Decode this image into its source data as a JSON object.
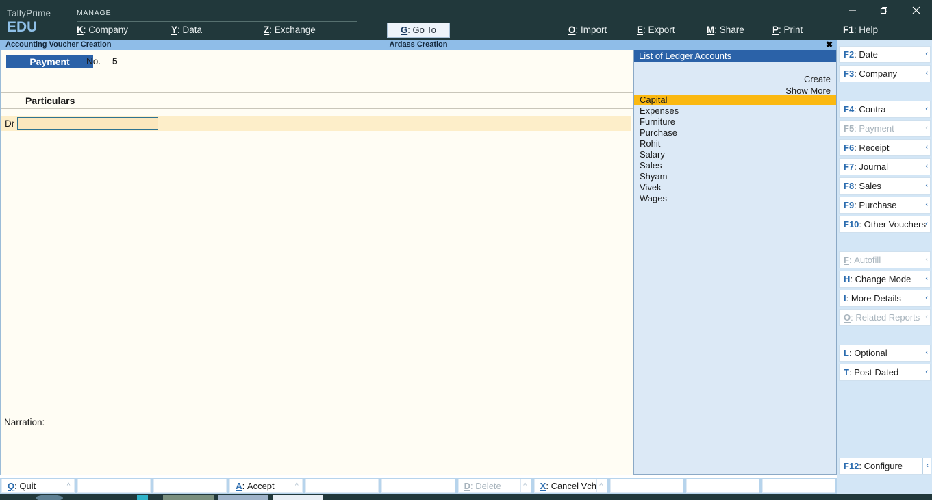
{
  "app": {
    "brand_name": "TallyPrime",
    "brand_edition": "EDU"
  },
  "topbar": {
    "section_label": "MANAGE",
    "left_menu": [
      {
        "key": "K",
        "label": "Company"
      },
      {
        "key": "Y",
        "label": "Data"
      },
      {
        "key": "Z",
        "label": "Exchange"
      }
    ],
    "goto": {
      "key": "G",
      "label": "Go To"
    },
    "right_menu": [
      {
        "key": "O",
        "label": "Import"
      },
      {
        "key": "E",
        "label": "Export"
      },
      {
        "key": "M",
        "label": "Share"
      },
      {
        "key": "P",
        "label": "Print"
      },
      {
        "key": "F1",
        "label": "Help"
      }
    ],
    "window_controls": [
      {
        "name": "minimize-icon"
      },
      {
        "name": "restore-icon"
      },
      {
        "name": "close-icon"
      }
    ]
  },
  "subtitle_bar": {
    "left": "Accounting Voucher Creation",
    "center": "Ardass Creation",
    "close": "✖"
  },
  "voucher": {
    "type_badge": "Payment",
    "number_label": "No.",
    "number_value": "5",
    "column_header": "Particulars",
    "entry_side": "Dr",
    "entry_value": "",
    "narration_label": "Narration:"
  },
  "ledger_panel": {
    "title": "List of Ledger Accounts",
    "actions": [
      "Create",
      "Show More"
    ],
    "items": [
      "Capital",
      "Expenses",
      "Furniture",
      "Purchase",
      "Rohit",
      "Salary",
      "Sales",
      "Shyam",
      "Vivek",
      "Wages"
    ],
    "selected_index": 0
  },
  "sidebar": {
    "groups": [
      {
        "items": [
          {
            "key": "F2",
            "label": "Date",
            "disabled": false,
            "underline_key": false
          },
          {
            "key": "F3",
            "label": "Company",
            "disabled": false,
            "underline_key": false
          }
        ]
      },
      {
        "items": [
          {
            "key": "F4",
            "label": "Contra",
            "disabled": false,
            "underline_key": false
          },
          {
            "key": "F5",
            "label": "Payment",
            "disabled": true,
            "underline_key": false
          },
          {
            "key": "F6",
            "label": "Receipt",
            "disabled": false,
            "underline_key": false
          },
          {
            "key": "F7",
            "label": "Journal",
            "disabled": false,
            "underline_key": false
          },
          {
            "key": "F8",
            "label": "Sales",
            "disabled": false,
            "underline_key": false
          },
          {
            "key": "F9",
            "label": "Purchase",
            "disabled": false,
            "underline_key": false
          },
          {
            "key": "F10",
            "label": "Other Vouchers",
            "disabled": false,
            "underline_key": false
          }
        ]
      },
      {
        "items": [
          {
            "key": "F",
            "label": "Autofill",
            "disabled": true,
            "underline_key": true
          },
          {
            "key": "H",
            "label": "Change Mode",
            "disabled": false,
            "underline_key": true
          },
          {
            "key": "I",
            "label": "More Details",
            "disabled": false,
            "underline_key": true
          },
          {
            "key": "O",
            "label": "Related Reports",
            "disabled": true,
            "underline_key": true
          }
        ]
      },
      {
        "items": [
          {
            "key": "L",
            "label": "Optional",
            "disabled": false,
            "underline_key": true
          },
          {
            "key": "T",
            "label": "Post-Dated",
            "disabled": false,
            "underline_key": true
          }
        ]
      }
    ],
    "footer": {
      "key": "F12",
      "label": "Configure",
      "disabled": false,
      "underline_key": false
    },
    "chevron": "‹"
  },
  "bottom_bar": {
    "buttons": [
      {
        "key": "Q",
        "label": "Quit",
        "disabled": false,
        "caret": true
      },
      {
        "key": "",
        "label": "",
        "disabled": false,
        "caret": false
      },
      {
        "key": "",
        "label": "",
        "disabled": false,
        "caret": false
      },
      {
        "key": "A",
        "label": "Accept",
        "disabled": false,
        "caret": true
      },
      {
        "key": "",
        "label": "",
        "disabled": false,
        "caret": false
      },
      {
        "key": "",
        "label": "",
        "disabled": false,
        "caret": false
      },
      {
        "key": "D",
        "label": "Delete",
        "disabled": true,
        "caret": true
      },
      {
        "key": "X",
        "label": "Cancel Vch",
        "disabled": false,
        "caret": true
      },
      {
        "key": "",
        "label": "",
        "disabled": false,
        "caret": false
      },
      {
        "key": "",
        "label": "",
        "disabled": false,
        "caret": false
      },
      {
        "key": "",
        "label": "",
        "disabled": false,
        "caret": false
      }
    ]
  },
  "colors": {
    "topbar_bg": "#21383b",
    "accent_blue": "#2b62a8",
    "subbar_blue": "#8fbde8",
    "panel_blue": "#dce9f6",
    "selection_amber": "#fbb810",
    "voucher_bg": "#fffdf4",
    "input_cream": "#fbe7bd",
    "sidebar_bg": "#d3e6f6"
  }
}
